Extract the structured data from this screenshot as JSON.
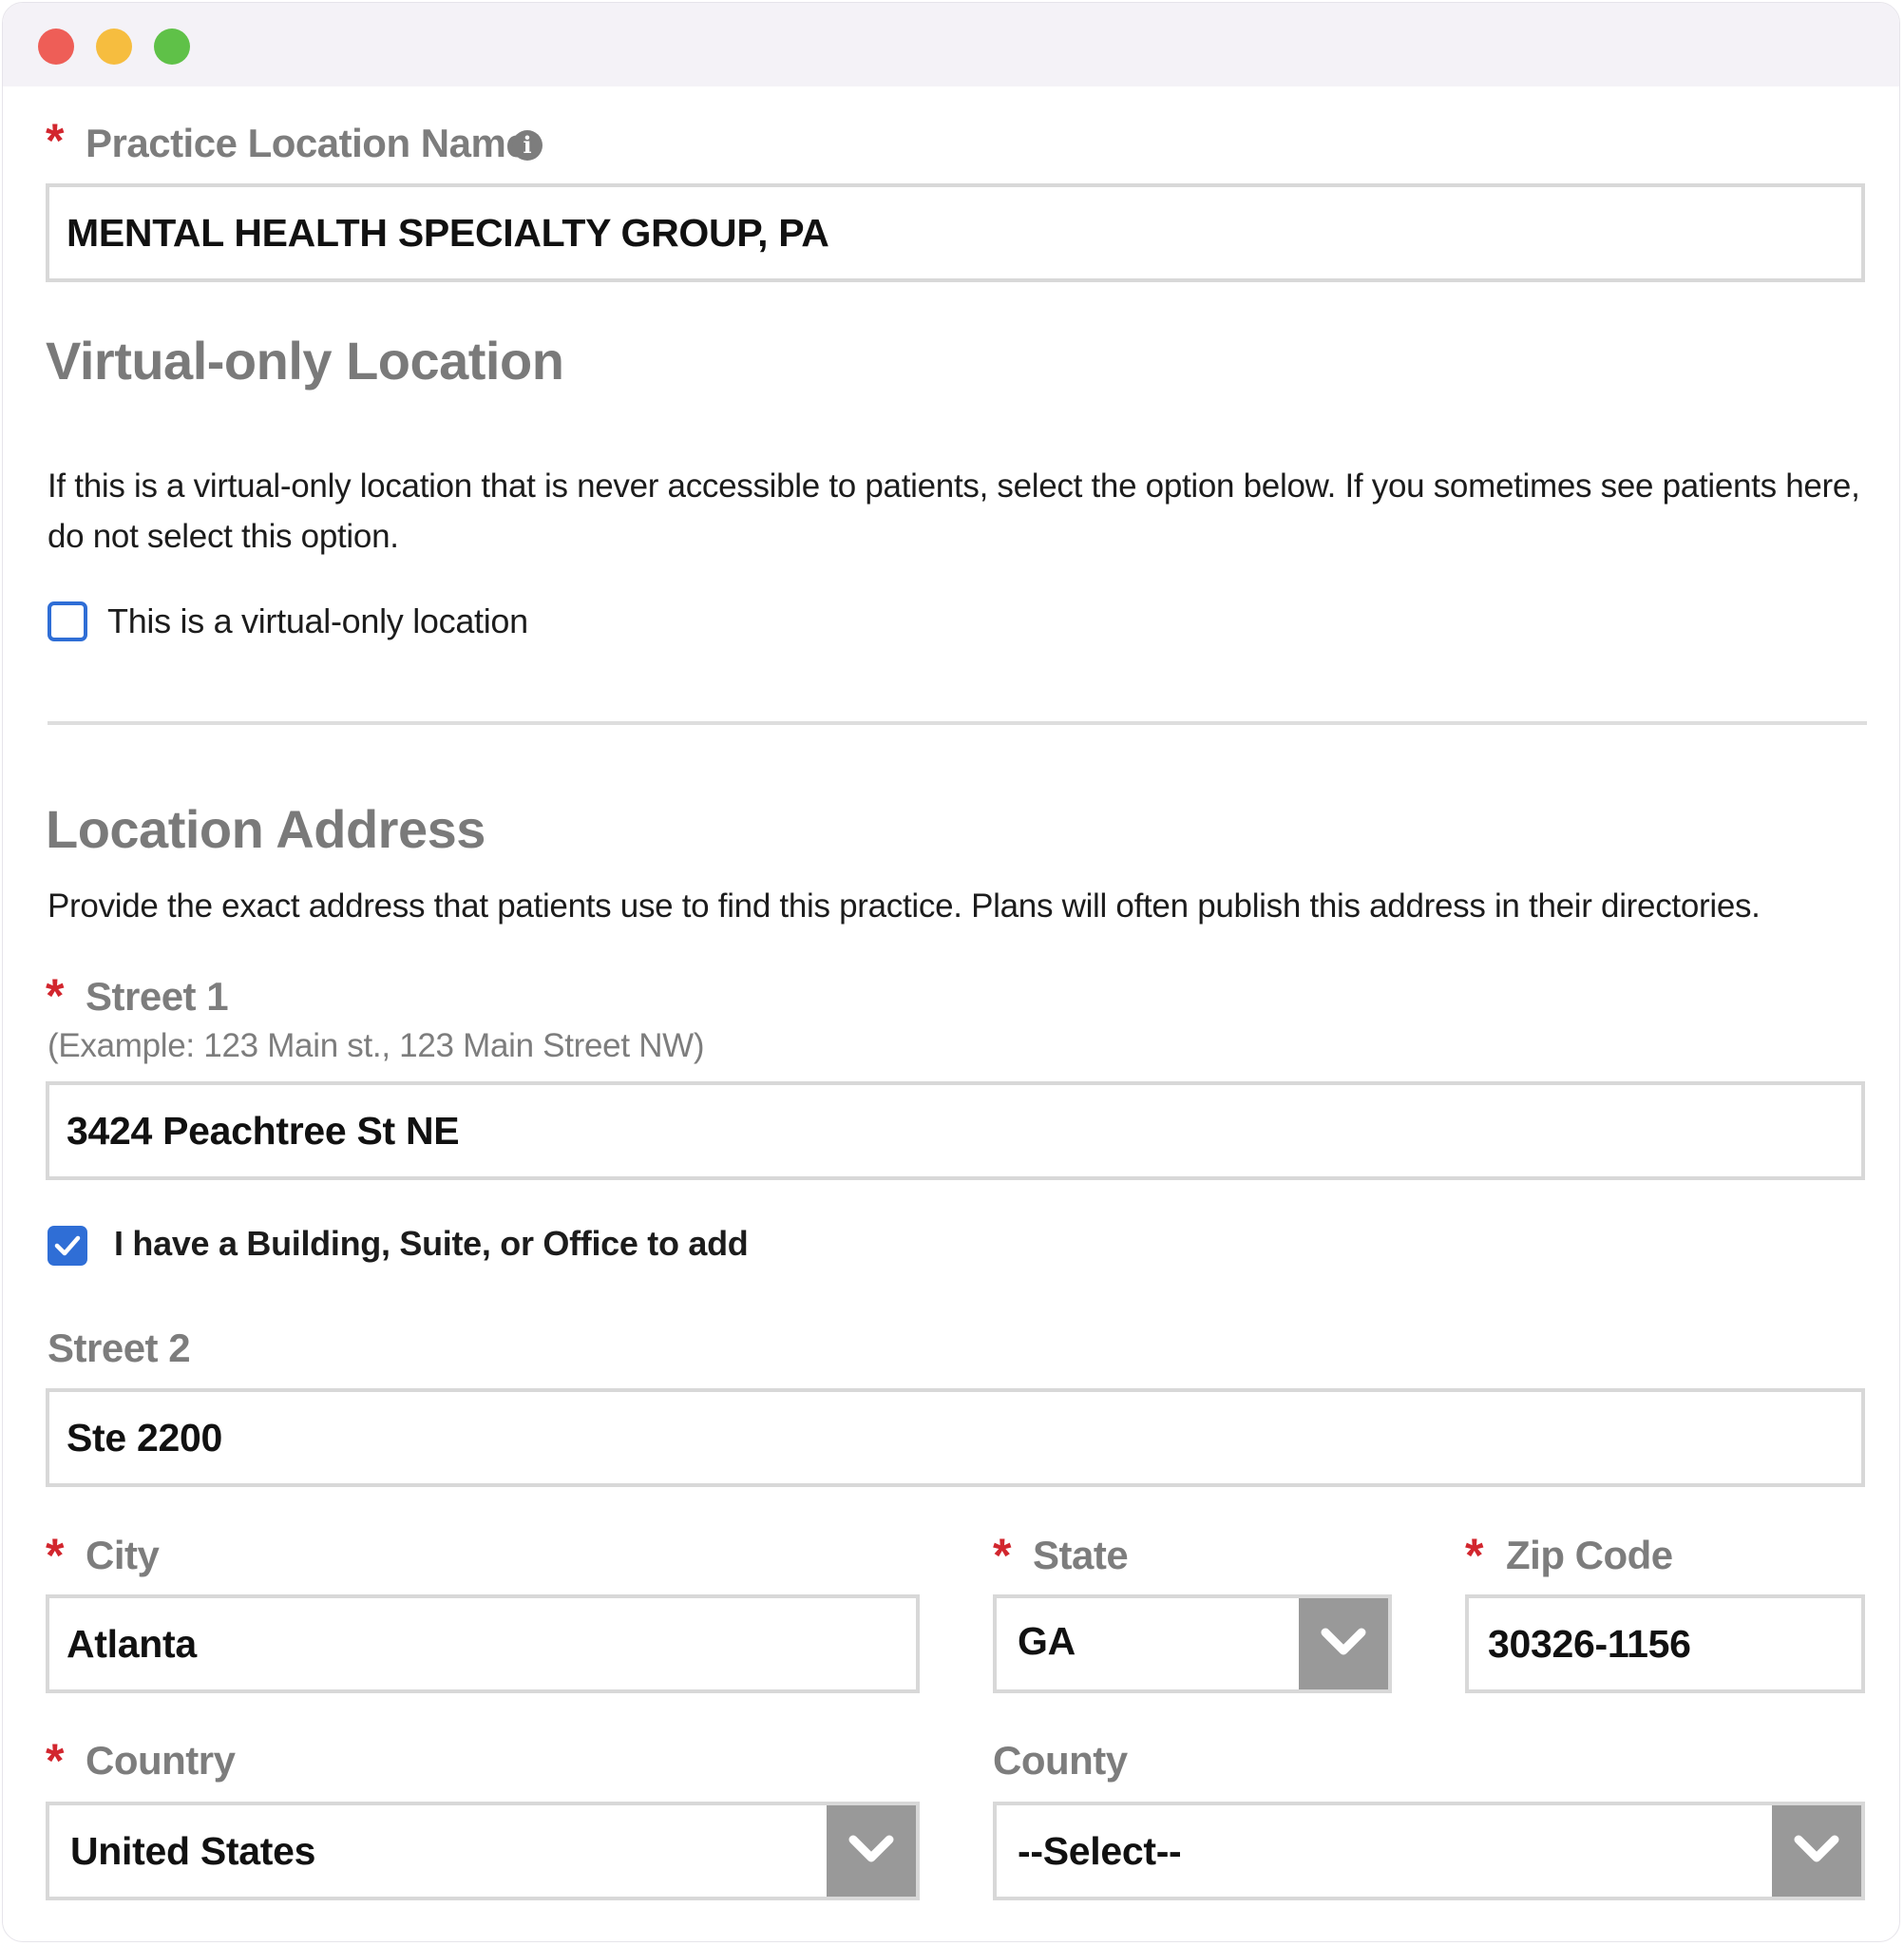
{
  "window": {
    "controls": [
      "close",
      "minimize",
      "maximize"
    ]
  },
  "practice_location_name": {
    "label": "Practice Location Name",
    "required": "*",
    "info_icon": "i",
    "value": "MENTAL HEALTH SPECIALTY GROUP, PA"
  },
  "virtual": {
    "heading": "Virtual-only Location",
    "description": "If this is a virtual-only location that is never accessible to patients, select the option below. If you sometimes see patients here, do not select this option.",
    "checkbox_label": "This is a virtual-only location",
    "checked": false
  },
  "address": {
    "heading": "Location Address",
    "description": "Provide the exact address that patients use to find this practice. Plans will often publish this address in their directories.",
    "street1": {
      "label": "Street 1",
      "required": "*",
      "hint": "(Example: 123 Main st., 123 Main Street NW)",
      "value": "3424 Peachtree St NE"
    },
    "suite_checkbox": {
      "label": "I have a Building, Suite, or Office to add",
      "checked": true
    },
    "street2": {
      "label": "Street 2",
      "value": "Ste 2200"
    },
    "city": {
      "label": "City",
      "required": "*",
      "value": "Atlanta"
    },
    "state": {
      "label": "State",
      "required": "*",
      "value": "GA"
    },
    "zip": {
      "label": "Zip Code",
      "required": "*",
      "value": "30326-1156"
    },
    "country": {
      "label": "Country",
      "required": "*",
      "value": "United States"
    },
    "county": {
      "label": "County",
      "value": "--Select--"
    }
  },
  "colors": {
    "required": "#d2262e",
    "checkbox": "#2f6ed6",
    "select_button": "#999999"
  }
}
